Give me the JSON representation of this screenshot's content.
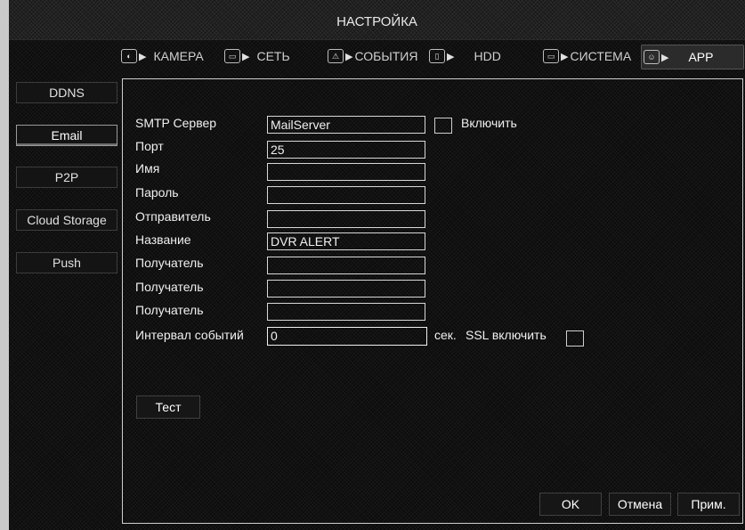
{
  "window": {
    "title": "НАСТРОЙКА"
  },
  "tabs": [
    {
      "label": "КАМЕРА",
      "icon": "camera-icon"
    },
    {
      "label": "СЕТЬ",
      "icon": "network-icon"
    },
    {
      "label": "СОБЫТИЯ",
      "icon": "alarm-icon"
    },
    {
      "label": "HDD",
      "icon": "hdd-icon"
    },
    {
      "label": "СИСТЕМА",
      "icon": "monitor-icon"
    },
    {
      "label": "APP",
      "icon": "app-icon"
    }
  ],
  "sidebar": {
    "items": [
      {
        "label": "DDNS"
      },
      {
        "label": "Email"
      },
      {
        "label": "P2P"
      },
      {
        "label": "Cloud Storage"
      },
      {
        "label": "Push"
      }
    ]
  },
  "form": {
    "smtp_server": {
      "label": "SMTP Сервер",
      "value": "MailServer"
    },
    "enable": {
      "label": "Включить",
      "checked": false
    },
    "port": {
      "label": "Порт",
      "value": "25"
    },
    "name": {
      "label": "Имя",
      "value": ""
    },
    "password": {
      "label": "Пароль",
      "value": ""
    },
    "sender": {
      "label": "Отправитель",
      "value": ""
    },
    "subject": {
      "label": "Название",
      "value": "DVR ALERT"
    },
    "recipient1": {
      "label": "Получатель",
      "value": ""
    },
    "recipient2": {
      "label": "Получатель",
      "value": ""
    },
    "recipient3": {
      "label": "Получатель",
      "value": ""
    },
    "interval": {
      "label": "Интервал событий",
      "value": "0",
      "unit": "сек."
    },
    "ssl": {
      "label": "SSL включить",
      "checked": false
    }
  },
  "buttons": {
    "test": "Тест",
    "ok": "OK",
    "cancel": "Отмена",
    "apply": "Прим."
  }
}
